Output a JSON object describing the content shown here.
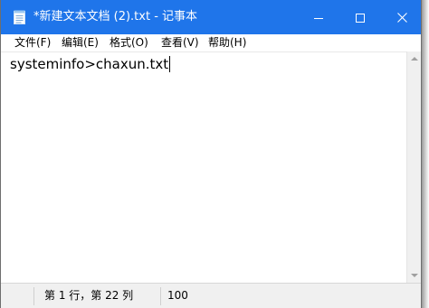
{
  "window": {
    "title": "*新建文本文档 (2).txt - 记事本",
    "titlebar_color": "#1f75ea"
  },
  "controls": {
    "minimize_icon": "minimize-icon",
    "maximize_icon": "maximize-icon",
    "close_icon": "close-icon"
  },
  "menu": {
    "items": [
      {
        "label": "文件(F)"
      },
      {
        "label": "编辑(E)"
      },
      {
        "label": "格式(O)"
      },
      {
        "label": "查看(V)"
      },
      {
        "label": "帮助(H)"
      }
    ]
  },
  "editor": {
    "content": "systeminfo>chaxun.txt"
  },
  "status": {
    "position": "第 1 行，第 22 列",
    "zoom": "100"
  }
}
